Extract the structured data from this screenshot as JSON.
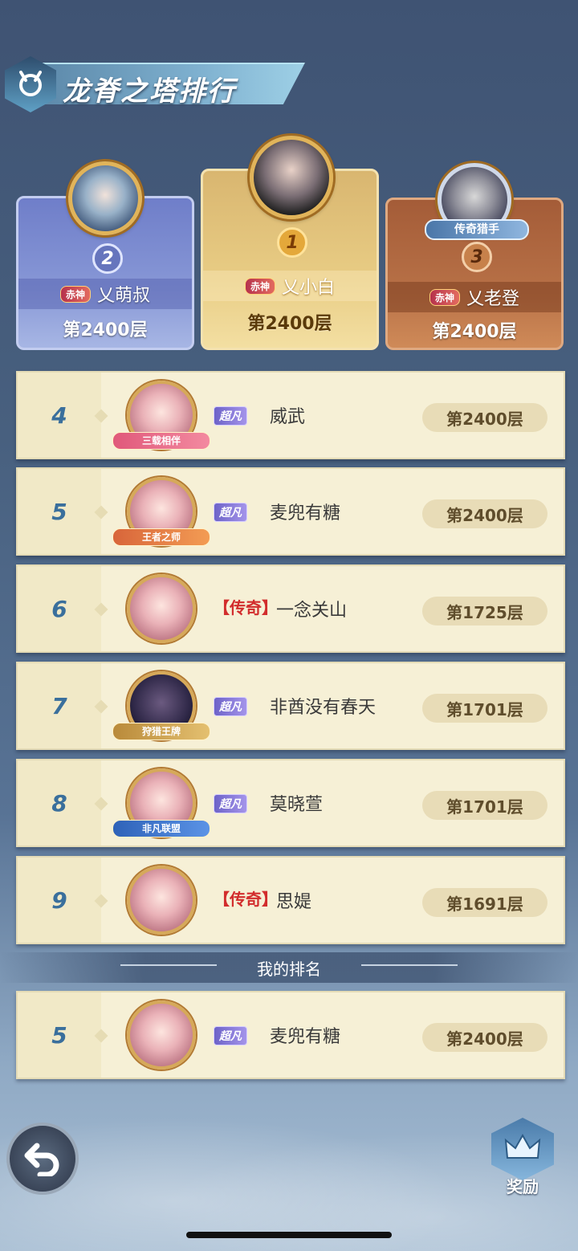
{
  "header": {
    "title": "龙脊之塔排行"
  },
  "podium": [
    {
      "rank": "1",
      "name": "乂小白",
      "floor": "第2400层",
      "tier_badge": "赤神"
    },
    {
      "rank": "2",
      "name": "乂萌叔",
      "floor": "第2400层",
      "tier_badge": "赤神"
    },
    {
      "rank": "3",
      "name": "乂老登",
      "floor": "第2400层",
      "tier_badge": "赤神",
      "title_badge": "传奇猎手"
    }
  ],
  "list": [
    {
      "rank": "4",
      "tier": "超凡",
      "name": "威武",
      "floor": "第2400层",
      "plate": "三载相伴"
    },
    {
      "rank": "5",
      "tier": "超凡",
      "name": "麦兜有糖",
      "floor": "第2400层",
      "plate": "王者之师"
    },
    {
      "rank": "6",
      "tier": "【传奇】",
      "name": "一念关山",
      "floor": "第1725层",
      "plate": ""
    },
    {
      "rank": "7",
      "tier": "超凡",
      "name": "非酋没有春天",
      "floor": "第1701层",
      "plate": "狩猎王牌"
    },
    {
      "rank": "8",
      "tier": "超凡",
      "name": "莫晓萱",
      "floor": "第1701层",
      "plate": "非凡联盟"
    },
    {
      "rank": "9",
      "tier": "【传奇】",
      "name": "思媞",
      "floor": "第1691层",
      "plate": ""
    }
  ],
  "my_rank": {
    "label": "我的排名",
    "rank": "5",
    "tier": "超凡",
    "name": "麦兜有糖",
    "floor": "第2400层"
  },
  "buttons": {
    "reward_label": "奖励"
  }
}
